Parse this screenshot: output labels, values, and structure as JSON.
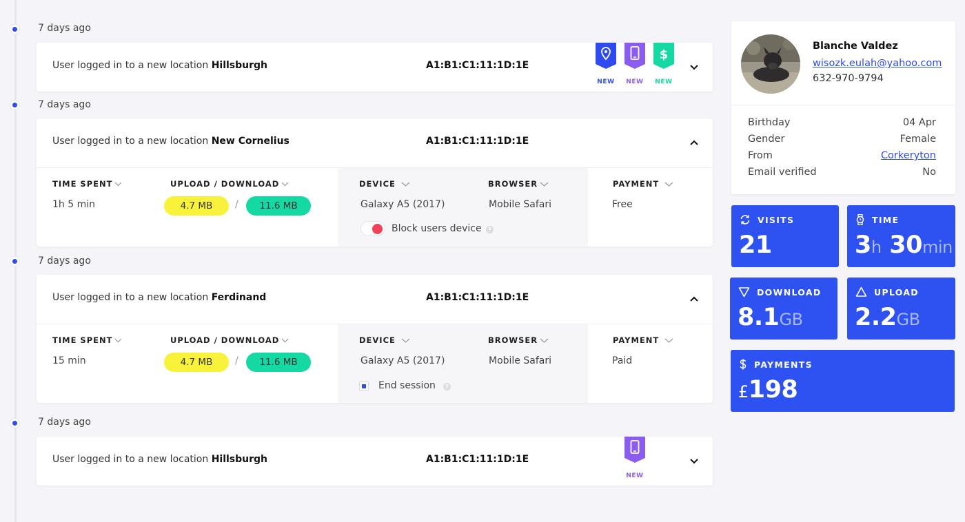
{
  "timeline": [
    {
      "ago": "7 days ago",
      "message": "User logged in to a new location",
      "location": "Hillsburgh",
      "mac": "A1:B1:C1:11:1D:1E",
      "badges": [
        {
          "icon": "location-pin-icon",
          "label": "NEW",
          "color": "#2d4bf0"
        },
        {
          "icon": "phone-icon",
          "label": "NEW",
          "color": "#8a5cf0"
        },
        {
          "icon": "dollar-icon",
          "label": "NEW",
          "color": "#14d9a3"
        }
      ]
    },
    {
      "ago": "7 days ago",
      "message": "User logged in to a new location",
      "location": "New Cornelius",
      "mac": "A1:B1:C1:11:1D:1E",
      "details": {
        "time_spent_label": "TIME SPENT",
        "time_spent": "1h 5 min",
        "updown_label": "UPLOAD / DOWNLOAD",
        "upload": "4.7 MB",
        "download": "11.6 MB",
        "separator": "/",
        "device_label": "DEVICE",
        "device": "Galaxy A5 (2017)",
        "browser_label": "BROWSER",
        "browser": "Mobile Safari",
        "payment_label": "PAYMENT",
        "payment": "Free",
        "option_label": "Block users device"
      }
    },
    {
      "ago": "7 days ago",
      "message": "User logged in to a new location",
      "location": "Ferdinand",
      "mac": "A1:B1:C1:11:1D:1E",
      "details": {
        "time_spent_label": "TIME SPENT",
        "time_spent": "15 min",
        "updown_label": "UPLOAD / DOWNLOAD",
        "upload": "4.7 MB",
        "download": "11.6 MB",
        "separator": "/",
        "device_label": "DEVICE",
        "device": "Galaxy A5 (2017)",
        "browser_label": "BROWSER",
        "browser": "Mobile Safari",
        "payment_label": "PAYMENT",
        "payment": "Paid",
        "option_label": "End session"
      }
    },
    {
      "ago": "7 days ago",
      "message": "User logged in to a new location",
      "location": "Hillsburgh",
      "mac": "A1:B1:C1:11:1D:1E",
      "badges": [
        {
          "icon": "phone-icon",
          "label": "NEW",
          "color": "#8a5cf0"
        }
      ]
    }
  ],
  "profile": {
    "name": "Blanche Valdez",
    "email": "wisozk.eulah@yahoo.com",
    "phone": "632-970-9794",
    "rows": [
      {
        "label": "Birthday",
        "value": "04 Apr"
      },
      {
        "label": "Gender",
        "value": "Female"
      },
      {
        "label": "From",
        "value": "Corkeryton"
      },
      {
        "label": "Email verified",
        "value": "No"
      }
    ]
  },
  "stats": {
    "visits": {
      "label": "VISITS",
      "value": "21",
      "icon": "refresh-icon"
    },
    "time": {
      "label": "TIME",
      "hours": "3",
      "h_unit": "h",
      "minutes": "30",
      "m_unit": "min",
      "icon": "watch-icon"
    },
    "download": {
      "label": "DOWNLOAD",
      "value": "8.1",
      "unit": "GB",
      "icon": "triangle-down-icon"
    },
    "upload": {
      "label": "UPLOAD",
      "value": "2.2",
      "unit": "GB",
      "icon": "triangle-up-icon"
    },
    "payments": {
      "label": "PAYMENTS",
      "currency": "£",
      "value": "198",
      "icon": "dollar-icon"
    }
  },
  "colors": {
    "accent": "#2e52f1",
    "upload_pill": "#f8f23a",
    "download_pill": "#14d9a3",
    "toggle_on": "#f2425a"
  }
}
